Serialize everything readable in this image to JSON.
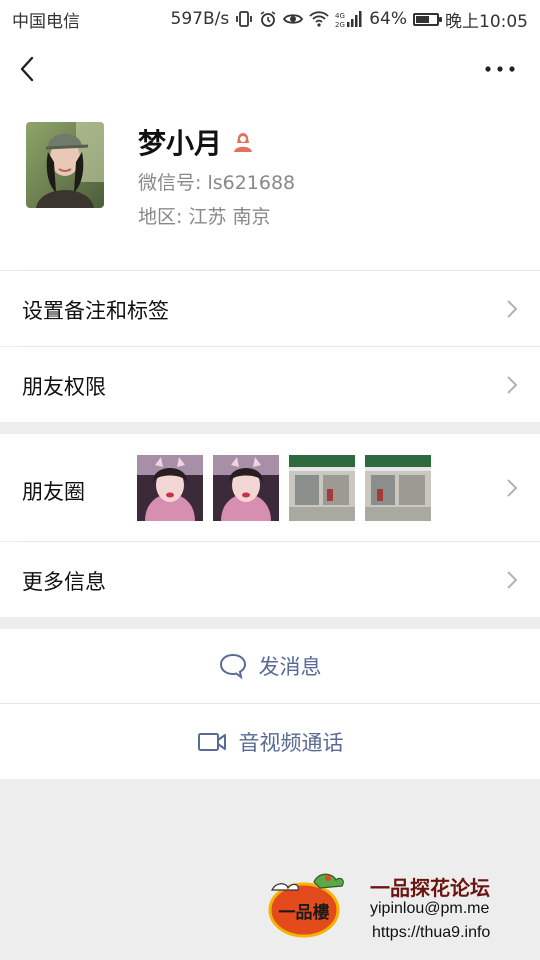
{
  "status_bar": {
    "carrier": "中国电信",
    "speed": "597B/s",
    "signal_type": "4G",
    "battery": "64%",
    "battery_level": 0.64,
    "time": "晚上10:05"
  },
  "profile": {
    "name": "梦小月",
    "wechat_id": "微信号:  ls621688",
    "region": "地区:  江苏  南京",
    "gender_icon": "female-icon",
    "gender_color": "#e2725b"
  },
  "menu": {
    "remark_tags": "设置备注和标签",
    "permissions": "朋友权限",
    "moments": "朋友圈",
    "more_info": "更多信息"
  },
  "actions": {
    "send_message": "发消息",
    "video_call": "音视频通话"
  },
  "watermark": {
    "title": "一品探花论坛",
    "email": "yipinlou@pm.me",
    "url": "https://thua9.info",
    "logo_text": "一品樓"
  },
  "colors": {
    "link_blue": "#576b95",
    "secondary_text": "#888888",
    "background": "#ededed"
  }
}
